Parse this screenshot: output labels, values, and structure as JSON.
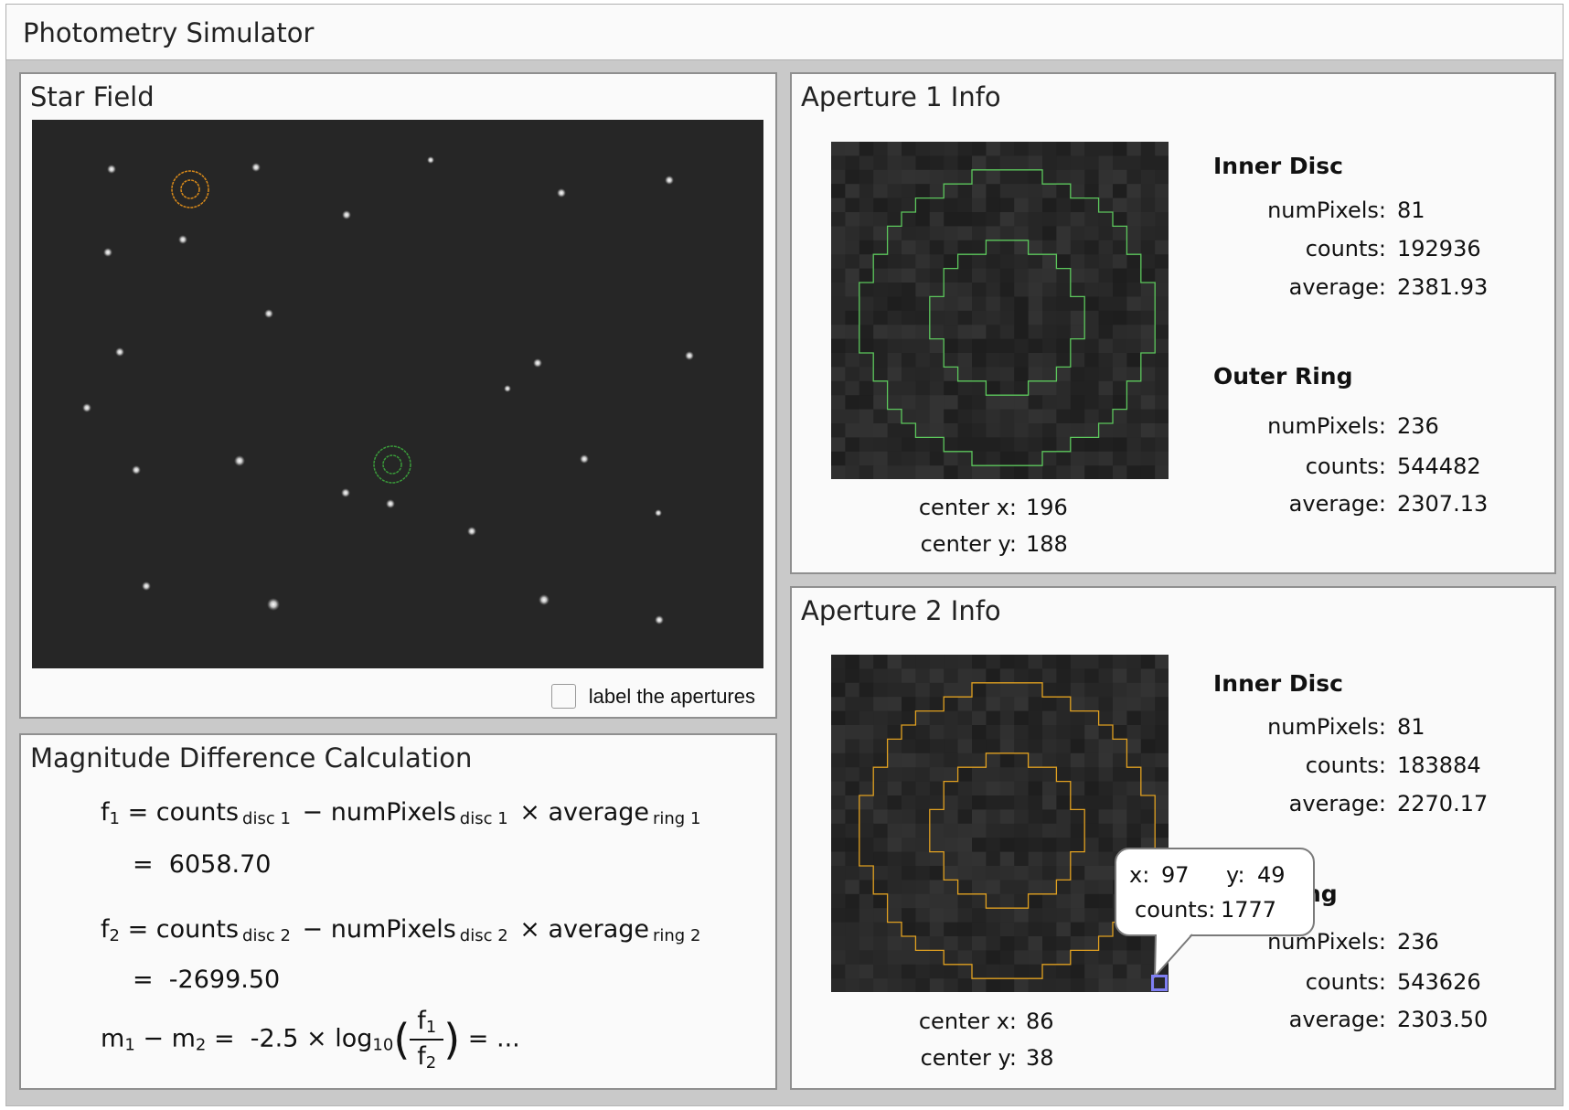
{
  "app": {
    "title": "Photometry Simulator"
  },
  "star_field": {
    "title": "Star Field",
    "label_checkbox": {
      "label": "label the apertures",
      "checked": false
    },
    "aperture_colors": {
      "aperture_1": "#3a9a3a",
      "aperture_2": "#d98a1a"
    }
  },
  "calculation": {
    "title": "Magnitude Difference Calculation",
    "f1": {
      "lhs": "f",
      "lhs_sub": "1",
      "counts": "counts",
      "counts_sub": "disc 1",
      "minus": "−",
      "numpixels": "numPixels",
      "numpixels_sub": "disc 1",
      "times": "×",
      "average": "average",
      "average_sub": "ring 1",
      "equals": "=",
      "result": "6058.70"
    },
    "f2": {
      "lhs": "f",
      "lhs_sub": "2",
      "counts": "counts",
      "counts_sub": "disc 2",
      "minus": "−",
      "numpixels": "numPixels",
      "numpixels_sub": "disc 2",
      "times": "×",
      "average": "average",
      "average_sub": "ring 2",
      "equals": "=",
      "result": "-2699.50"
    },
    "magnitude": {
      "m1": "m",
      "m1_sub": "1",
      "minus": "−",
      "m2": "m",
      "m2_sub": "2",
      "equals": "=",
      "factor": "-2.5",
      "times": "×",
      "log": "log",
      "log_base": "10",
      "open_paren": "(",
      "num": "f",
      "num_sub": "1",
      "den": "f",
      "den_sub": "2",
      "close_paren": ")",
      "equals2": "=",
      "result": "..."
    }
  },
  "aperture1": {
    "title": "Aperture 1 Info",
    "outline_color": "#5cc75c",
    "center_x_label": "center x:",
    "center_x": "196",
    "center_y_label": "center y:",
    "center_y": "188",
    "inner_disc": {
      "heading": "Inner Disc",
      "numpixels_label": "numPixels:",
      "numpixels": "81",
      "counts_label": "counts:",
      "counts": "192936",
      "average_label": "average:",
      "average": "2381.93"
    },
    "outer_ring": {
      "heading": "Outer Ring",
      "numpixels_label": "numPixels:",
      "numpixels": "236",
      "counts_label": "counts:",
      "counts": "544482",
      "average_label": "average:",
      "average": "2307.13"
    }
  },
  "aperture2": {
    "title": "Aperture 2 Info",
    "outline_color": "#e0a020",
    "center_x_label": "center x:",
    "center_x": "86",
    "center_y_label": "center y:",
    "center_y": "38",
    "inner_disc": {
      "heading": "Inner Disc",
      "numpixels_label": "numPixels:",
      "numpixels": "81",
      "counts_label": "counts:",
      "counts": "183884",
      "average_label": "average:",
      "average": "2270.17"
    },
    "outer_ring": {
      "heading_visible": "ng",
      "numpixels_label": "numPixels:",
      "numpixels": "236",
      "counts_label": "counts:",
      "counts": "543626",
      "average_label": "average:",
      "average": "2303.50"
    }
  },
  "tooltip": {
    "x_label": "x:",
    "x": "97",
    "y_label": "y:",
    "y": "49",
    "counts_label": "counts:",
    "counts": "1777",
    "cursor_color": "#7f7ff2"
  }
}
